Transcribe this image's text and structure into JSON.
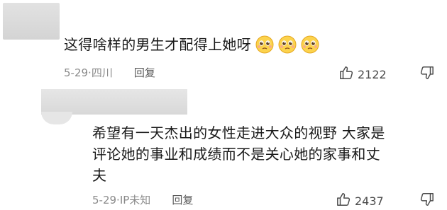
{
  "comments": [
    {
      "text": "这得啥样的男生才配得上她呀",
      "emojis": [
        "pleading-face",
        "pleading-face",
        "pleading-face"
      ],
      "date": "5-29",
      "location": "四川",
      "reply_label": "回复",
      "likes": "2122"
    },
    {
      "text_line1": "希望有一天杰出的女性走进大众的视野 大家是",
      "text_line2": "评论她的事业和成绩而不是关心她的家事和丈",
      "text_line3": "夫",
      "date": "5-29",
      "location": "IP未知",
      "reply_label": "回复",
      "likes": "2437"
    }
  ]
}
